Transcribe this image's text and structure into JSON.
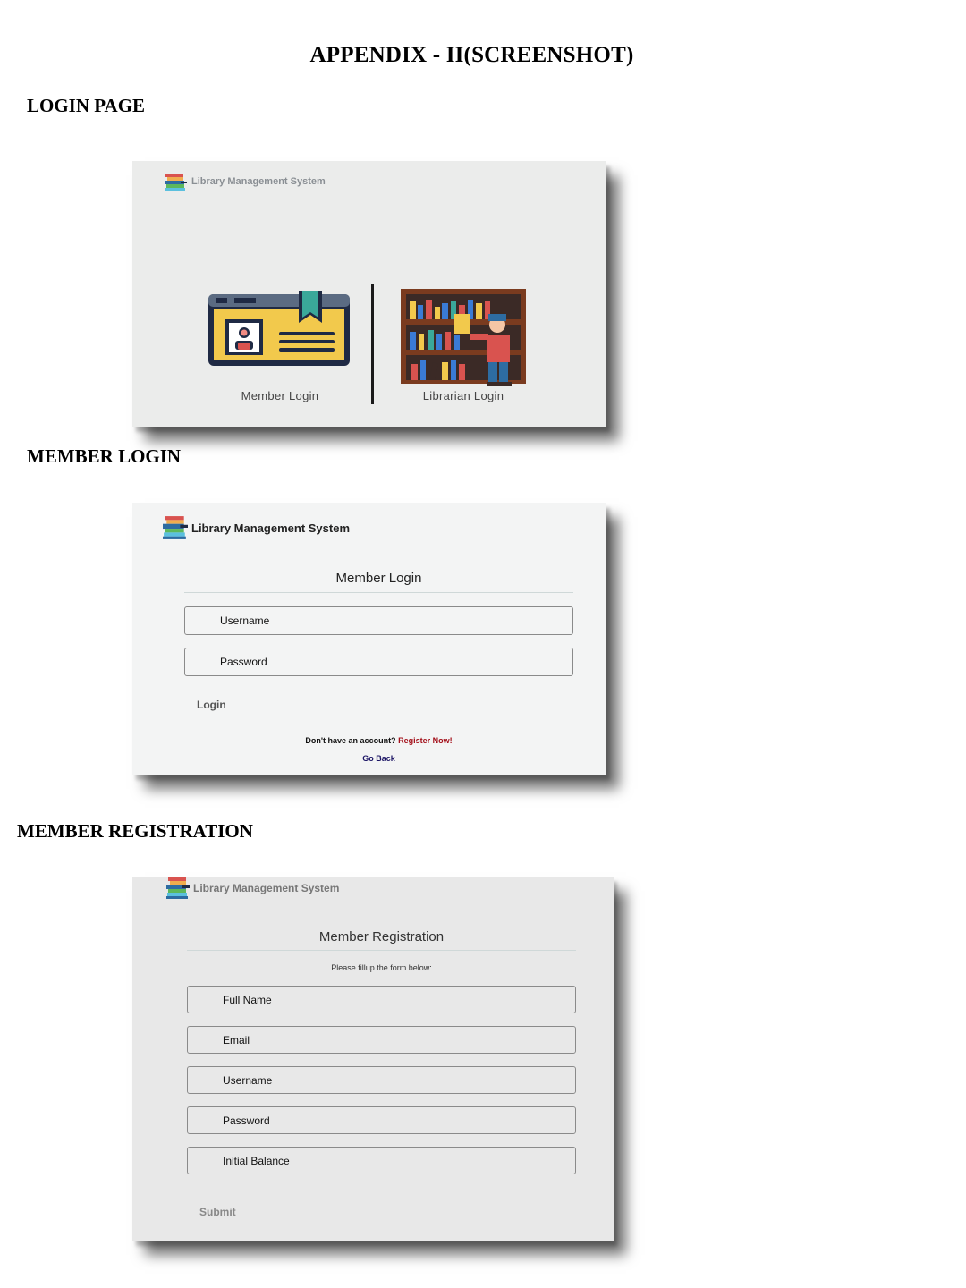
{
  "document": {
    "title": "APPENDIX - II(SCREENSHOT)"
  },
  "sections": {
    "login_page": {
      "heading": "LOGIN PAGE",
      "brand": "Library Management System",
      "member_option_label": "Member Login",
      "librarian_option_label": "Librarian Login",
      "member_icon": "member-card-icon",
      "librarian_icon": "bookshelf-librarian-icon"
    },
    "member_login": {
      "heading": "MEMBER LOGIN",
      "brand": "Library Management System",
      "form_title": "Member Login",
      "username_placeholder": "Username",
      "password_placeholder": "Password",
      "login_label": "Login",
      "no_account_text": "Don't have an account?",
      "register_link": "Register Now!",
      "go_back_link": "Go Back"
    },
    "member_registration": {
      "heading": "MEMBER REGISTRATION",
      "brand": "Library Management System",
      "form_title": "Member Registration",
      "instruction": "Please fillup the form below:",
      "full_name_placeholder": "Full Name",
      "email_placeholder": "Email",
      "username_placeholder": "Username",
      "password_placeholder": "Password",
      "initial_balance_placeholder": "Initial Balance",
      "submit_label": "Submit"
    }
  },
  "colors": {
    "card_yellow": "#f2c94c",
    "card_outline": "#1f2a44",
    "bookmark_teal": "#3aa89a",
    "shelf_brown": "#7a3b1f",
    "link_red": "#a3101a",
    "link_navy": "#1b1464"
  }
}
